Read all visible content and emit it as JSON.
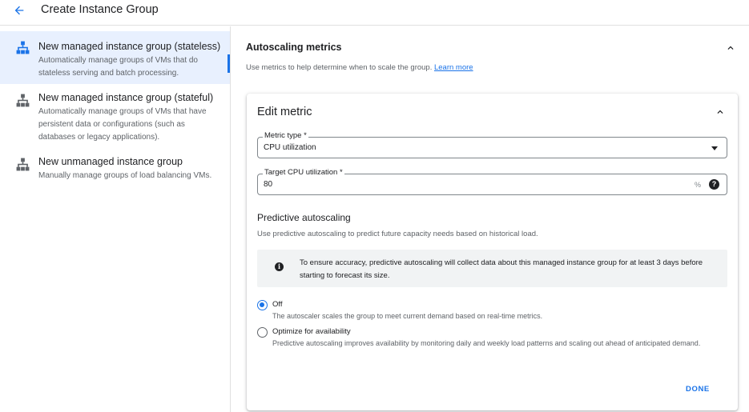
{
  "header": {
    "title": "Create Instance Group",
    "back_icon": "arrow-back-icon"
  },
  "sidebar": {
    "items": [
      {
        "title": "New managed instance group (stateless)",
        "description": "Automatically manage groups of VMs that do stateless serving and batch processing.",
        "icon": "instance-group-icon",
        "active": true
      },
      {
        "title": "New managed instance group (stateful)",
        "description": "Automatically manage groups of VMs that have persistent data or configurations (such as databases or legacy applications).",
        "icon": "instance-group-icon",
        "active": false
      },
      {
        "title": "New unmanaged instance group",
        "description": "Manually manage groups of load balancing VMs.",
        "icon": "instance-group-icon",
        "active": false
      }
    ]
  },
  "autoscaling": {
    "title": "Autoscaling metrics",
    "description": "Use metrics to help determine when to scale the group.",
    "learn_more": "Learn more"
  },
  "edit_metric": {
    "title": "Edit metric",
    "metric_type": {
      "label": "Metric type *",
      "value": "CPU utilization"
    },
    "target": {
      "label": "Target CPU utilization *",
      "value": "80",
      "suffix": "%",
      "help_icon": "?"
    },
    "predictive": {
      "title": "Predictive autoscaling",
      "description": "Use predictive autoscaling to predict future capacity needs based on historical load.",
      "info_icon": "i",
      "info_text": "To ensure accuracy, predictive autoscaling will collect data about this managed instance group for at least 3 days before starting to forecast its size.",
      "options": [
        {
          "label": "Off",
          "description": "The autoscaler scales the group to meet current demand based on real-time metrics.",
          "selected": true
        },
        {
          "label": "Optimize for availability",
          "description": "Predictive autoscaling improves availability by monitoring daily and weekly load patterns and scaling out ahead of anticipated demand.",
          "selected": false
        }
      ]
    },
    "done_label": "DONE"
  },
  "colors": {
    "accent": "#1a73e8",
    "active_background": "#e8f0fe",
    "info_background": "#f1f3f4"
  }
}
